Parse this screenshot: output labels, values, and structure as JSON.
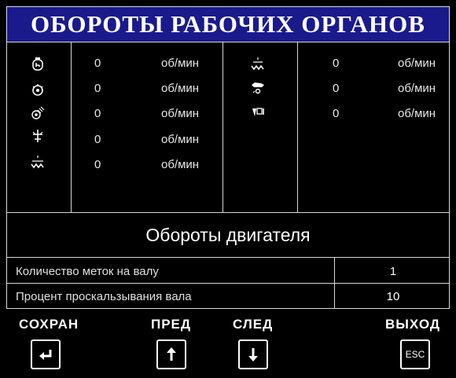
{
  "header": {
    "title": "ОБОРОТЫ РАБОЧИХ ОРГАНОВ"
  },
  "left_column": [
    {
      "icon": "engine-icon",
      "value": "0",
      "unit": "об/мин"
    },
    {
      "icon": "drum-icon",
      "value": "0",
      "unit": "об/мин"
    },
    {
      "icon": "fan-icon",
      "value": "0",
      "unit": "об/мин"
    },
    {
      "icon": "beater-icon",
      "value": "0",
      "unit": "об/мин"
    },
    {
      "icon": "chopper-icon",
      "value": "0",
      "unit": "об/мин"
    }
  ],
  "right_column": [
    {
      "icon": "straw-walker-icon",
      "value": "0",
      "unit": "об/мин"
    },
    {
      "icon": "feeder-icon",
      "value": "0",
      "unit": "об/мин"
    },
    {
      "icon": "header-icon",
      "value": "0",
      "unit": "об/мин"
    }
  ],
  "section_title": "Обороты двигателя",
  "settings": [
    {
      "label": "Количество меток на валу",
      "value": "1"
    },
    {
      "label": "Процент проскальзывания вала",
      "value": "10"
    }
  ],
  "buttons": {
    "save": "СОХРАН",
    "prev": "ПРЕД",
    "next": "СЛЕД",
    "exit": "ВЫХОД",
    "esc_key": "ESC"
  }
}
